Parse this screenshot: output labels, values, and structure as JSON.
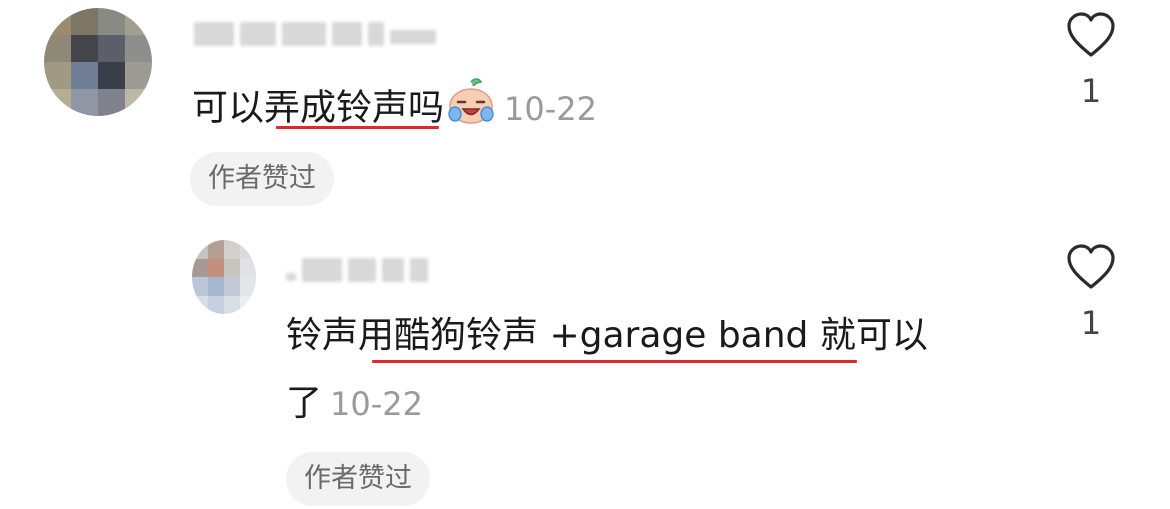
{
  "comments": [
    {
      "text": "可以弄成铃声吗",
      "time": "10-22",
      "badge": "作者赞过",
      "likes": "1",
      "emoji": "crying-face-emoji",
      "avatar_colors": [
        "#9b8c70",
        "#7d7664",
        "#8a8a84",
        "#a39f8f",
        "#8f8778",
        "#434548",
        "#5b5f69",
        "#8e8e8a",
        "#a19a83",
        "#6f7e96",
        "#3a3f4c",
        "#9e9b93",
        "#b5ad96",
        "#8f97a7",
        "#7f828d",
        "#bdb7a8"
      ]
    },
    {
      "text": "铃声用酷狗铃声 +garage band 就可以",
      "text_line2": "了",
      "time": "10-22",
      "badge": "作者赞过",
      "likes": "1",
      "avatar_colors": [
        "#c8c2bd",
        "#b49f92",
        "#d3d0ce",
        "#d8dbe0",
        "#a79a92",
        "#c48f7e",
        "#c8c4c0",
        "#e0e2e6",
        "#b9c7d9",
        "#a6b7cf",
        "#c3cbd6",
        "#e3e5e8",
        "#d6dde7",
        "#c4d0df",
        "#d9dee5",
        "#eceef1"
      ]
    }
  ],
  "accent_color": "#e0282e"
}
